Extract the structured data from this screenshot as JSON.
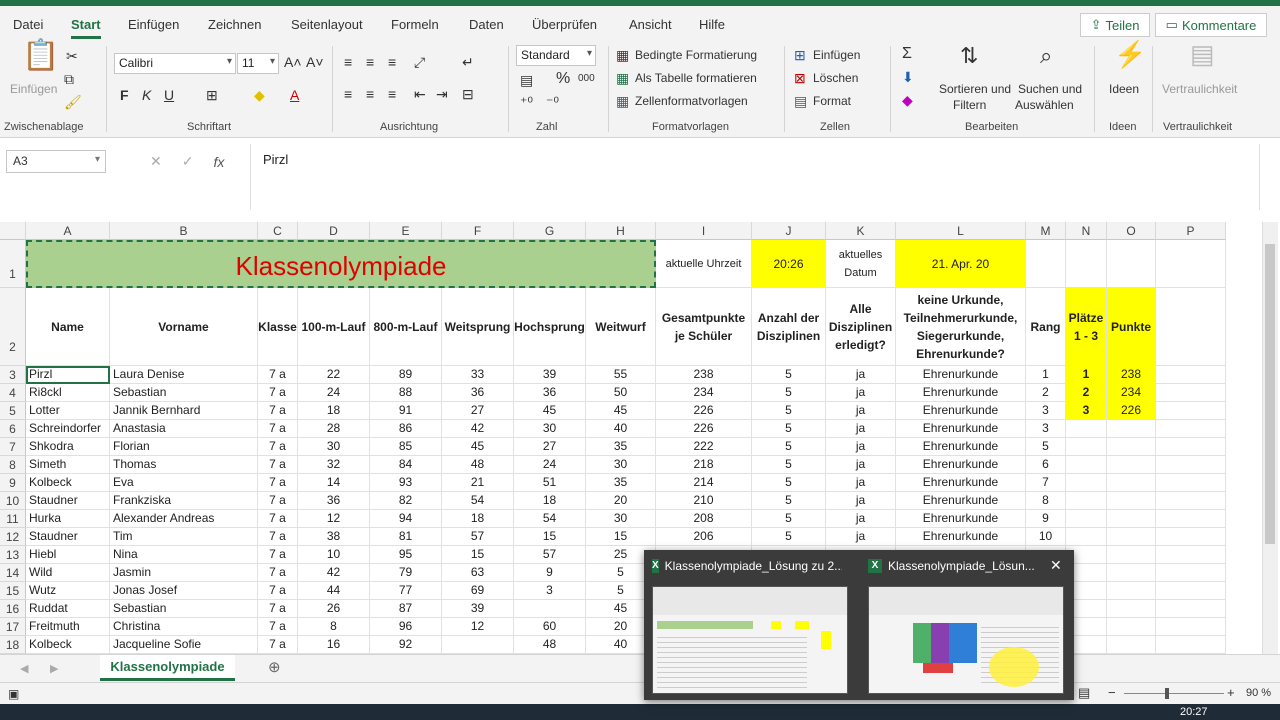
{
  "menu": {
    "tabs": [
      "Datei",
      "Start",
      "Einfügen",
      "Zeichnen",
      "Seitenlayout",
      "Formeln",
      "Daten",
      "Überprüfen",
      "Ansicht",
      "Hilfe"
    ],
    "active_tab": "Start",
    "share": "Teilen",
    "comment": "Kommentare"
  },
  "ribbon": {
    "clipboard": {
      "paste": "Einfügen",
      "label": "Zwischenablage"
    },
    "font": {
      "name": "Calibri",
      "size": "11",
      "bold": "F",
      "italic": "K",
      "underline": "U",
      "label": "Schriftart"
    },
    "alignment": {
      "label": "Ausrichtung"
    },
    "number": {
      "format": "Standard",
      "percent": "%",
      "thousands": "000",
      "label": "Zahl"
    },
    "styles": {
      "conditional": "Bedingte Formatierung",
      "as_table": "Als Tabelle formatieren",
      "cell_styles": "Zellenformatvorlagen",
      "label": "Formatvorlagen"
    },
    "cells": {
      "insert": "Einfügen",
      "delete": "Löschen",
      "format": "Format",
      "label": "Zellen"
    },
    "editing": {
      "sort1": "Sortieren und",
      "sort2": "Filtern",
      "find1": "Suchen und",
      "find2": "Auswählen",
      "label": "Bearbeiten"
    },
    "ideas": {
      "button": "Ideen",
      "label": "Ideen"
    },
    "privacy": {
      "button": "Vertraulichkeit",
      "label": "Vertraulichkeit"
    }
  },
  "formula_bar": {
    "name_box": "A3",
    "fx": "fx",
    "cancel": "✕",
    "enter": "✓",
    "value": "Pirzl"
  },
  "columns": [
    "A",
    "B",
    "C",
    "D",
    "E",
    "F",
    "G",
    "H",
    "I",
    "J",
    "K",
    "L",
    "M",
    "N",
    "O",
    "P"
  ],
  "row1": {
    "title": "Klassenolympiade",
    "time_label": "aktuelle Uhrzeit",
    "time_value": "20:26",
    "date_label": "aktuelles Datum",
    "date_value": "21. Apr. 20"
  },
  "headers": [
    "Name",
    "Vorname",
    "Klasse",
    "100-m-Lauf",
    "800-m-Lauf",
    "Weitsprung",
    "Hochsprung",
    "Weitwurf",
    "Gesamtpunkte je Schüler",
    "Anzahl der Disziplinen",
    "Alle Disziplinen erledigt?",
    "keine Urkunde, Teilnehmerurkunde, Siegerurkunde, Ehrenurkunde?",
    "Rang",
    "Plätze 1 - 3",
    "Punkte"
  ],
  "rows": [
    [
      "3",
      "Pirzl",
      "Laura Denise",
      "7 a",
      "22",
      "89",
      "33",
      "39",
      "55",
      "238",
      "5",
      "ja",
      "Ehrenurkunde",
      "1",
      "1",
      "238"
    ],
    [
      "4",
      "Ri8ckl",
      "Sebastian",
      "7 a",
      "24",
      "88",
      "36",
      "36",
      "50",
      "234",
      "5",
      "ja",
      "Ehrenurkunde",
      "2",
      "2",
      "234"
    ],
    [
      "5",
      "Lotter",
      "Jannik Bernhard",
      "7 a",
      "18",
      "91",
      "27",
      "45",
      "45",
      "226",
      "5",
      "ja",
      "Ehrenurkunde",
      "3",
      "3",
      "226"
    ],
    [
      "6",
      "Schreindorfer",
      "Anastasia",
      "7 a",
      "28",
      "86",
      "42",
      "30",
      "40",
      "226",
      "5",
      "ja",
      "Ehrenurkunde",
      "3",
      "",
      ""
    ],
    [
      "7",
      "Shkodra",
      "Florian",
      "7 a",
      "30",
      "85",
      "45",
      "27",
      "35",
      "222",
      "5",
      "ja",
      "Ehrenurkunde",
      "5",
      "",
      ""
    ],
    [
      "8",
      "Simeth",
      "Thomas",
      "7 a",
      "32",
      "84",
      "48",
      "24",
      "30",
      "218",
      "5",
      "ja",
      "Ehrenurkunde",
      "6",
      "",
      ""
    ],
    [
      "9",
      "Kolbeck",
      "Eva",
      "7 a",
      "14",
      "93",
      "21",
      "51",
      "35",
      "214",
      "5",
      "ja",
      "Ehrenurkunde",
      "7",
      "",
      ""
    ],
    [
      "10",
      "Staudner",
      "Frankziska",
      "7 a",
      "36",
      "82",
      "54",
      "18",
      "20",
      "210",
      "5",
      "ja",
      "Ehrenurkunde",
      "8",
      "",
      ""
    ],
    [
      "11",
      "Hurka",
      "Alexander Andreas",
      "7 a",
      "12",
      "94",
      "18",
      "54",
      "30",
      "208",
      "5",
      "ja",
      "Ehrenurkunde",
      "9",
      "",
      ""
    ],
    [
      "12",
      "Staudner",
      "Tim",
      "7 a",
      "38",
      "81",
      "57",
      "15",
      "15",
      "206",
      "5",
      "ja",
      "Ehrenurkunde",
      "10",
      "",
      ""
    ],
    [
      "13",
      "Hiebl",
      "Nina",
      "7 a",
      "10",
      "95",
      "15",
      "57",
      "25",
      "",
      "",
      "",
      "",
      "",
      "",
      ""
    ],
    [
      "14",
      "Wild",
      "Jasmin",
      "7 a",
      "42",
      "79",
      "63",
      "9",
      "5",
      "",
      "",
      "",
      "",
      "",
      "",
      ""
    ],
    [
      "15",
      "Wutz",
      "Jonas Josef",
      "7 a",
      "44",
      "77",
      "69",
      "3",
      "5",
      "",
      "",
      "",
      "",
      "",
      "",
      ""
    ],
    [
      "16",
      "Ruddat",
      "Sebastian",
      "7 a",
      "26",
      "87",
      "39",
      "",
      "45",
      "",
      "",
      "",
      "",
      "",
      "",
      ""
    ],
    [
      "17",
      "Freitmuth",
      "Christina",
      "7 a",
      "8",
      "96",
      "12",
      "60",
      "20",
      "",
      "",
      "",
      "",
      "",
      "",
      ""
    ],
    [
      "18",
      "Kolbeck",
      "Jacqueline Sofie",
      "7 a",
      "16",
      "92",
      "",
      "48",
      "40",
      "",
      "",
      "",
      "",
      "",
      "",
      ""
    ]
  ],
  "sheet_tab": "Klassenolympiade",
  "status": {
    "zoom": "90 %"
  },
  "taskbar": {
    "clock": "20:27"
  },
  "preview": {
    "title1": "Klassenolympiade_Lösung zu 2....",
    "title2": "Klassenolympiade_Lösun...",
    "close": "✕"
  },
  "colors": {
    "accent": "#217346",
    "title_fill": "#a9d08e",
    "title_text": "#e00000",
    "highlight": "#ffff00"
  }
}
